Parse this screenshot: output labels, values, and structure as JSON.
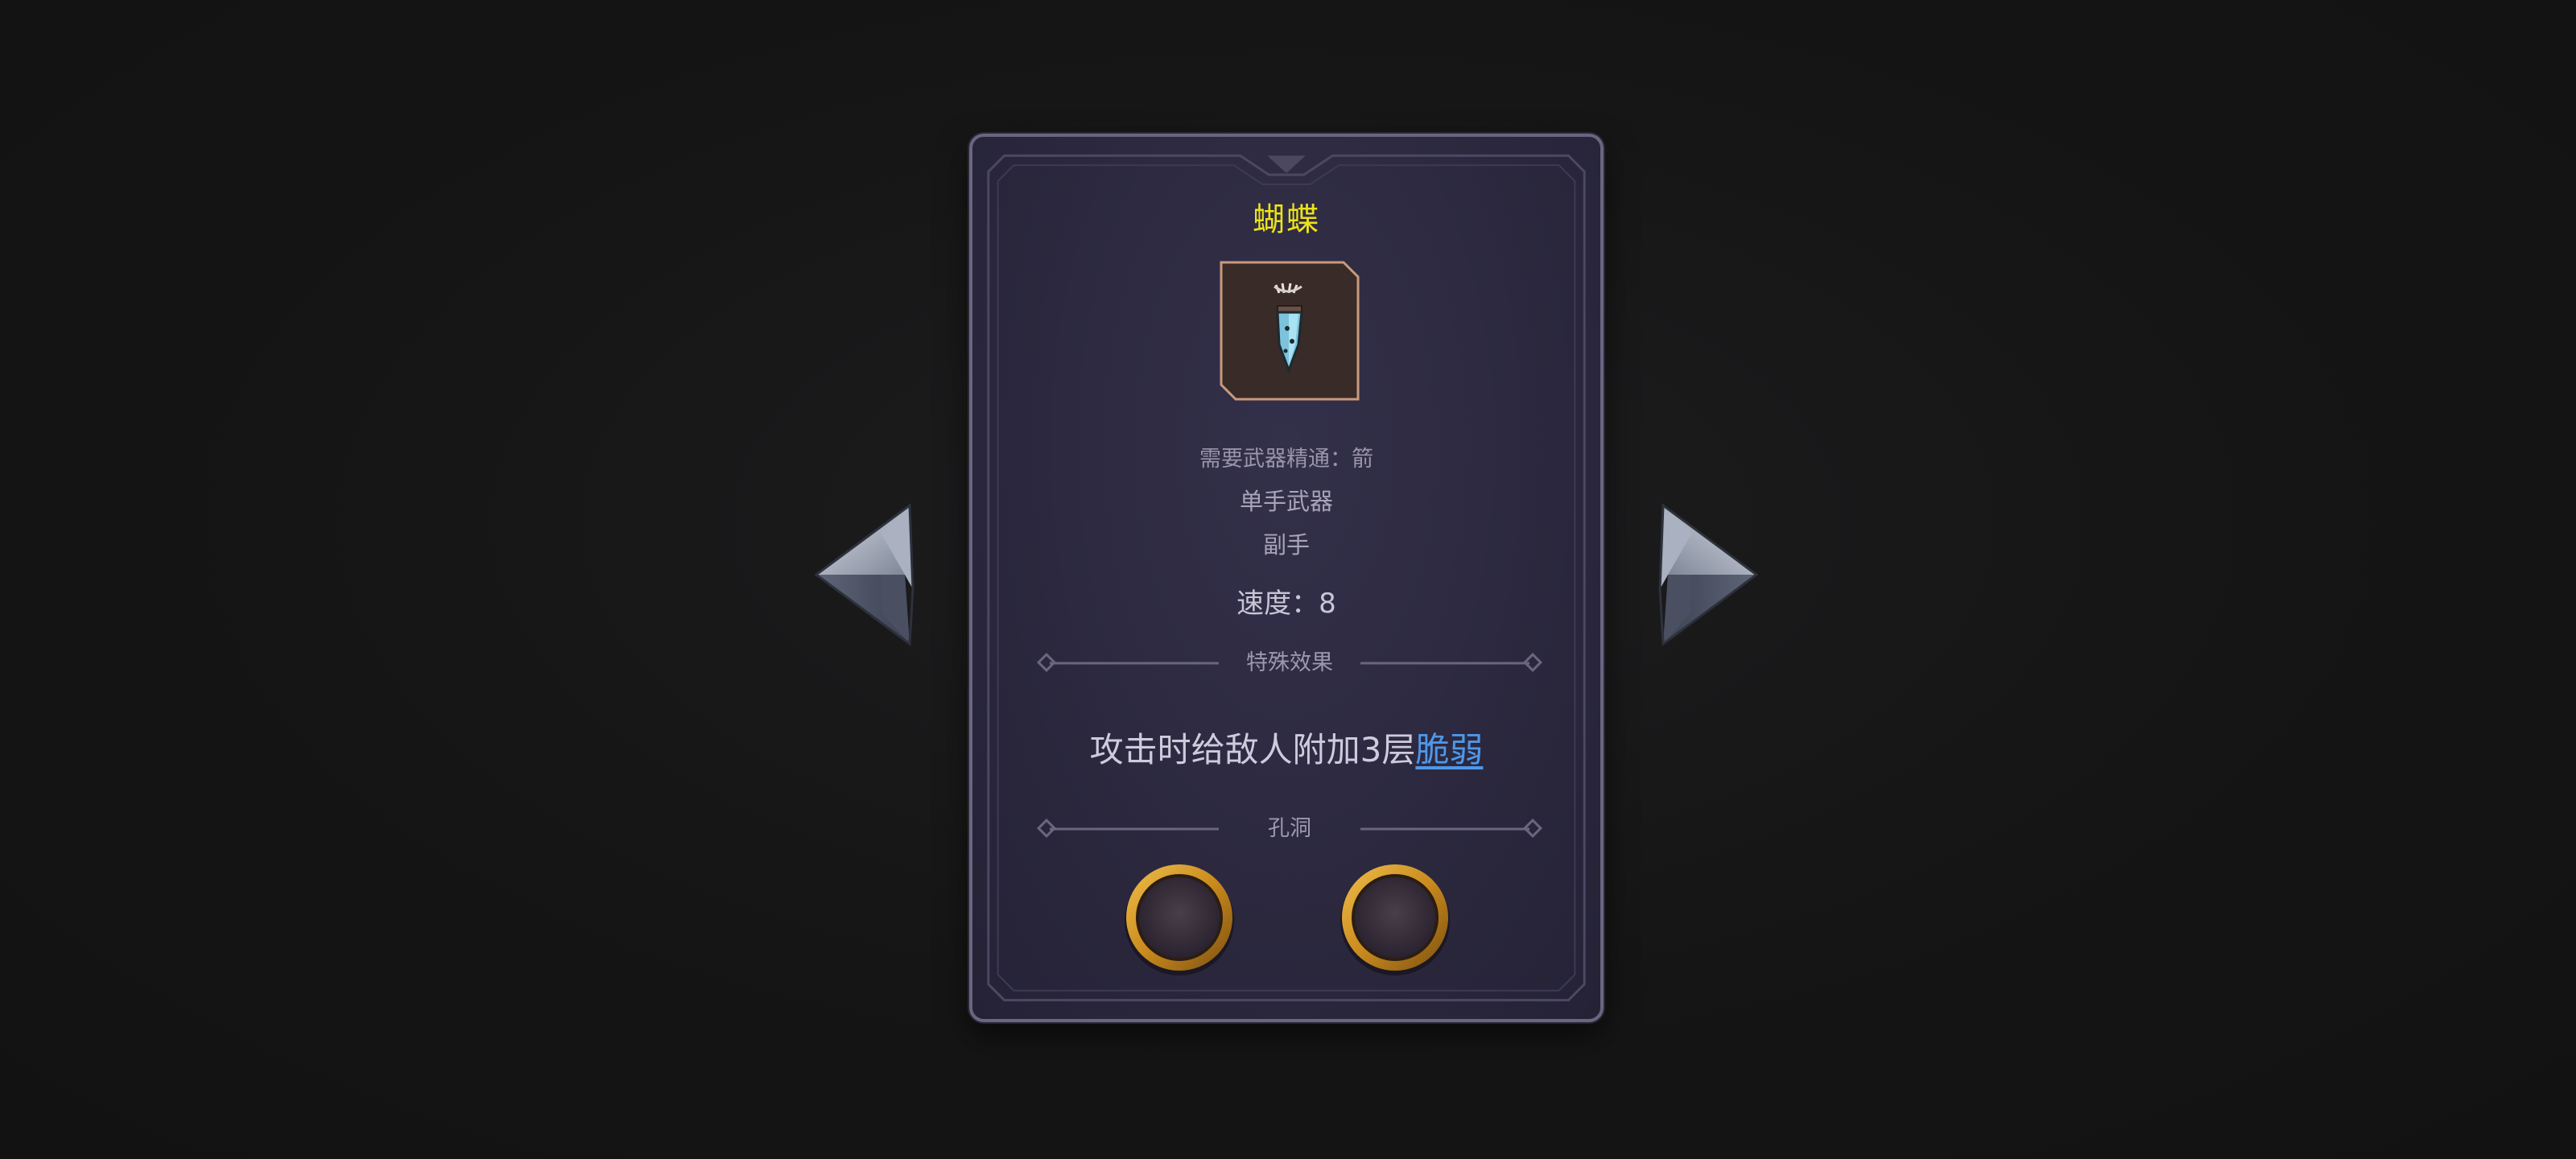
{
  "item": {
    "name": "蝴蝶",
    "icon": "butterfly-blade-icon",
    "requirement": "需要武器精通：箭",
    "hand_type": "单手武器",
    "slot": "副手",
    "speed": "速度：8"
  },
  "sections": {
    "effect_header": "特殊效果",
    "holes_header": "孔洞"
  },
  "effect": {
    "prefix": "攻击时给敌人附加3层",
    "keyword": "脆弱"
  },
  "sockets": [
    {
      "state": "empty"
    },
    {
      "state": "empty"
    }
  ],
  "navigation": {
    "prev_icon": "arrow-left-icon",
    "next_icon": "arrow-right-icon"
  },
  "colors": {
    "title": "#ece21a",
    "keyword": "#4f97e8",
    "card_bg": "#2b283e",
    "card_border": "#6c6580",
    "socket_ring": "#c98a1e"
  }
}
